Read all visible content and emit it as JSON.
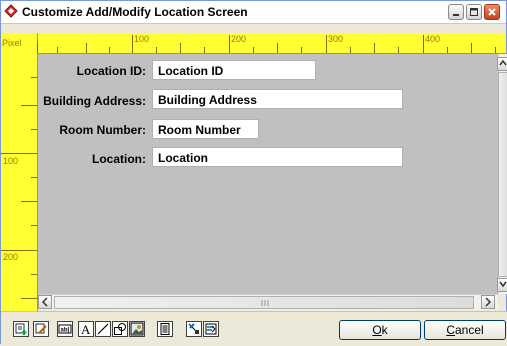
{
  "window": {
    "title": "Customize Add/Modify Location Screen"
  },
  "ruler": {
    "unit_label": "Pixel",
    "top_marks": [
      "100",
      "200",
      "300",
      "400"
    ],
    "left_marks": [
      "100",
      "200"
    ]
  },
  "form": {
    "fields": [
      {
        "label": "Location ID:",
        "value": "Location ID"
      },
      {
        "label": "Building Address:",
        "value": "Building Address"
      },
      {
        "label": "Room Number:",
        "value": "Room Number"
      },
      {
        "label": "Location:",
        "value": "Location"
      }
    ]
  },
  "toolbar": {
    "ok_label": "Ok",
    "ok_mnemonic": "O",
    "ok_rest": "k",
    "cancel_label": "Cancel",
    "cancel_mnemonic": "C",
    "cancel_rest": "ancel"
  },
  "colors": {
    "ruler": "#ffff33",
    "canvas": "#c0c0c0",
    "titlebar": "#ffffff"
  }
}
